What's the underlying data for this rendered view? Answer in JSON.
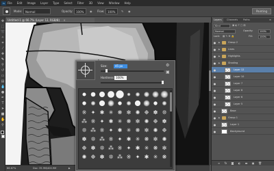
{
  "app": {
    "logo_text": "Ps"
  },
  "menu": [
    "File",
    "Edit",
    "Image",
    "Layer",
    "Type",
    "Select",
    "Filter",
    "3D",
    "View",
    "Window",
    "Help"
  ],
  "options_bar": {
    "mode_label": "Mode:",
    "mode_value": "Normal",
    "opacity_label": "Opacity:",
    "opacity_value": "100%",
    "flow_label": "Flow:",
    "flow_value": "100%",
    "workspace": "Painting"
  },
  "document": {
    "tab_title": "Untitled-1 @ 66.7% (Layer 12, RGB/8)",
    "close_glyph": "×",
    "zoom": "66.67%",
    "doc_size": "Doc: 35.9M/400.9M"
  },
  "brush_picker": {
    "size_label": "Size:",
    "size_value": "45 px",
    "hardness_label": "Hardness:",
    "hardness_value": "100%",
    "size_level": 0.08,
    "hardness_level": 1.0
  },
  "layers_panel": {
    "tabs": [
      "Layers",
      "Channels",
      "Paths"
    ],
    "filter_label": "Kind",
    "blend_mode": "Normal",
    "opacity_label": "Opacity:",
    "opacity_value": "100%",
    "lock_label": "Lock:",
    "fill_label": "Fill:",
    "fill_value": "100%",
    "layers": [
      {
        "name": "Group 2",
        "type": "group",
        "indent": 0,
        "selected": false
      },
      {
        "name": "Lines",
        "type": "group",
        "indent": 0,
        "selected": false
      },
      {
        "name": "Highlights",
        "type": "group",
        "indent": 0,
        "selected": false
      },
      {
        "name": "Shading",
        "type": "group",
        "indent": 0,
        "selected": false
      },
      {
        "name": "Layer 12",
        "type": "layer",
        "indent": 1,
        "selected": true
      },
      {
        "name": "Layer 10",
        "type": "layer",
        "indent": 1,
        "selected": false
      },
      {
        "name": "Layer 7",
        "type": "layer",
        "indent": 1,
        "selected": false
      },
      {
        "name": "Layer 8",
        "type": "layer",
        "indent": 1,
        "selected": false
      },
      {
        "name": "Layer 6",
        "type": "layer",
        "indent": 1,
        "selected": false
      },
      {
        "name": "Layer 5",
        "type": "layer",
        "indent": 1,
        "selected": false
      },
      {
        "name": "Base",
        "type": "layer",
        "indent": 0,
        "selected": false
      },
      {
        "name": "Group 1",
        "type": "group",
        "indent": 0,
        "selected": false
      },
      {
        "name": "Layer 1",
        "type": "layer",
        "indent": 0,
        "selected": false
      },
      {
        "name": "Background",
        "type": "background",
        "indent": 0,
        "selected": false
      }
    ]
  }
}
